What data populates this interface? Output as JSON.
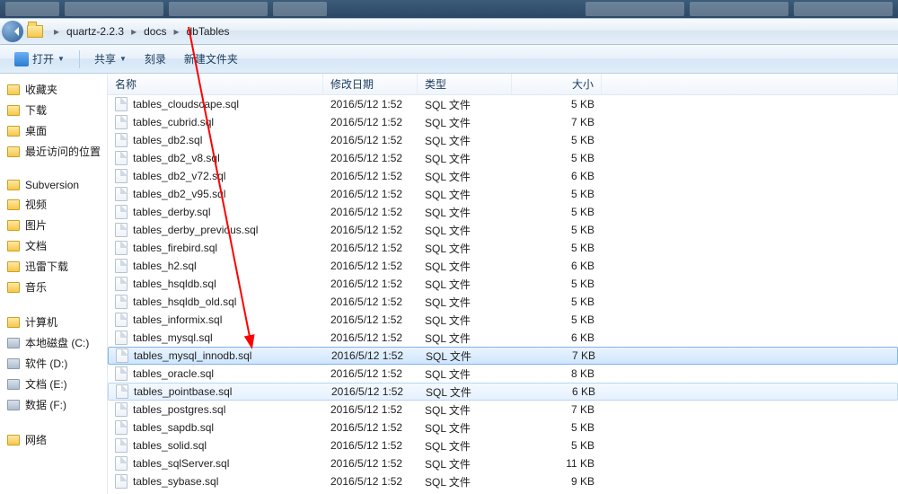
{
  "breadcrumb": {
    "parts": [
      "quartz-2.2.3",
      "docs",
      "dbTables"
    ]
  },
  "toolbar": {
    "open": "打开",
    "share": "共享",
    "burn": "刻录",
    "newfolder": "新建文件夹"
  },
  "columns": {
    "name": "名称",
    "date": "修改日期",
    "type": "类型",
    "size": "大小"
  },
  "sidebar": {
    "items": [
      {
        "label": "收藏夹",
        "kind": "section"
      },
      {
        "label": "下载",
        "kind": "item"
      },
      {
        "label": "桌面",
        "kind": "item"
      },
      {
        "label": "最近访问的位置",
        "kind": "item"
      },
      {
        "label": "",
        "kind": "gap"
      },
      {
        "label": "Subversion",
        "kind": "item"
      },
      {
        "label": "视频",
        "kind": "item"
      },
      {
        "label": "图片",
        "kind": "item"
      },
      {
        "label": "文档",
        "kind": "item"
      },
      {
        "label": "迅雷下载",
        "kind": "item"
      },
      {
        "label": "音乐",
        "kind": "item"
      },
      {
        "label": "",
        "kind": "gap"
      },
      {
        "label": "计算机",
        "kind": "item"
      },
      {
        "label": "本地磁盘 (C:)",
        "kind": "drive"
      },
      {
        "label": "软件 (D:)",
        "kind": "drive"
      },
      {
        "label": "文档 (E:)",
        "kind": "drive"
      },
      {
        "label": "数据 (F:)",
        "kind": "drive"
      },
      {
        "label": "",
        "kind": "gap"
      },
      {
        "label": "网络",
        "kind": "item"
      }
    ]
  },
  "files": [
    {
      "name": "tables_cloudscape.sql",
      "date": "2016/5/12 1:52",
      "type": "SQL 文件",
      "size": "5 KB",
      "state": ""
    },
    {
      "name": "tables_cubrid.sql",
      "date": "2016/5/12 1:52",
      "type": "SQL 文件",
      "size": "7 KB",
      "state": ""
    },
    {
      "name": "tables_db2.sql",
      "date": "2016/5/12 1:52",
      "type": "SQL 文件",
      "size": "5 KB",
      "state": ""
    },
    {
      "name": "tables_db2_v8.sql",
      "date": "2016/5/12 1:52",
      "type": "SQL 文件",
      "size": "5 KB",
      "state": ""
    },
    {
      "name": "tables_db2_v72.sql",
      "date": "2016/5/12 1:52",
      "type": "SQL 文件",
      "size": "6 KB",
      "state": ""
    },
    {
      "name": "tables_db2_v95.sql",
      "date": "2016/5/12 1:52",
      "type": "SQL 文件",
      "size": "5 KB",
      "state": ""
    },
    {
      "name": "tables_derby.sql",
      "date": "2016/5/12 1:52",
      "type": "SQL 文件",
      "size": "5 KB",
      "state": ""
    },
    {
      "name": "tables_derby_previous.sql",
      "date": "2016/5/12 1:52",
      "type": "SQL 文件",
      "size": "5 KB",
      "state": ""
    },
    {
      "name": "tables_firebird.sql",
      "date": "2016/5/12 1:52",
      "type": "SQL 文件",
      "size": "5 KB",
      "state": ""
    },
    {
      "name": "tables_h2.sql",
      "date": "2016/5/12 1:52",
      "type": "SQL 文件",
      "size": "6 KB",
      "state": ""
    },
    {
      "name": "tables_hsqldb.sql",
      "date": "2016/5/12 1:52",
      "type": "SQL 文件",
      "size": "5 KB",
      "state": ""
    },
    {
      "name": "tables_hsqldb_old.sql",
      "date": "2016/5/12 1:52",
      "type": "SQL 文件",
      "size": "5 KB",
      "state": ""
    },
    {
      "name": "tables_informix.sql",
      "date": "2016/5/12 1:52",
      "type": "SQL 文件",
      "size": "5 KB",
      "state": ""
    },
    {
      "name": "tables_mysql.sql",
      "date": "2016/5/12 1:52",
      "type": "SQL 文件",
      "size": "6 KB",
      "state": ""
    },
    {
      "name": "tables_mysql_innodb.sql",
      "date": "2016/5/12 1:52",
      "type": "SQL 文件",
      "size": "7 KB",
      "state": "selected"
    },
    {
      "name": "tables_oracle.sql",
      "date": "2016/5/12 1:52",
      "type": "SQL 文件",
      "size": "8 KB",
      "state": ""
    },
    {
      "name": "tables_pointbase.sql",
      "date": "2016/5/12 1:52",
      "type": "SQL 文件",
      "size": "6 KB",
      "state": "hover"
    },
    {
      "name": "tables_postgres.sql",
      "date": "2016/5/12 1:52",
      "type": "SQL 文件",
      "size": "7 KB",
      "state": ""
    },
    {
      "name": "tables_sapdb.sql",
      "date": "2016/5/12 1:52",
      "type": "SQL 文件",
      "size": "5 KB",
      "state": ""
    },
    {
      "name": "tables_solid.sql",
      "date": "2016/5/12 1:52",
      "type": "SQL 文件",
      "size": "5 KB",
      "state": ""
    },
    {
      "name": "tables_sqlServer.sql",
      "date": "2016/5/12 1:52",
      "type": "SQL 文件",
      "size": "11 KB",
      "state": ""
    },
    {
      "name": "tables_sybase.sql",
      "date": "2016/5/12 1:52",
      "type": "SQL 文件",
      "size": "9 KB",
      "state": ""
    }
  ]
}
